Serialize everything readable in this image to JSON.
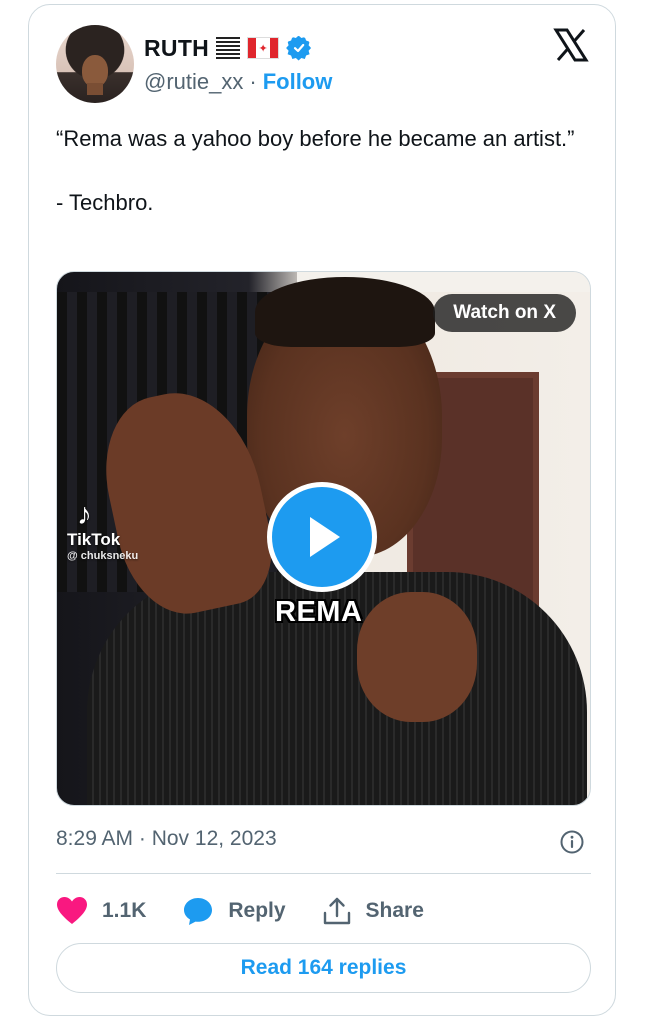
{
  "author": {
    "name": "RUTH",
    "handle": "@rutie_xx",
    "separator": "·",
    "follow_label": "Follow",
    "verified": true,
    "flag_emoji": "🇨🇦"
  },
  "tweet": {
    "text": "“Rema was a yahoo boy before he became an artist.”\n\n- Techbro."
  },
  "media": {
    "watch_label": "Watch on X",
    "tiktok_brand": "TikTok",
    "tiktok_user": "@ chuksneku",
    "caption": "REMA"
  },
  "meta": {
    "timestamp": "8:29 AM · Nov 12, 2023"
  },
  "actions": {
    "likes": "1.1K",
    "reply_label": "Reply",
    "share_label": "Share"
  },
  "read_replies_label": "Read 164 replies",
  "colors": {
    "accent": "#1d9bf0",
    "like": "#f91880",
    "muted": "#536471",
    "border": "#cfd9de"
  },
  "icons": {
    "brand": "x-logo-icon",
    "verified": "verified-badge-icon",
    "info": "info-icon",
    "like": "heart-icon",
    "reply": "chat-bubble-icon",
    "share": "share-upload-icon",
    "play": "play-icon"
  }
}
